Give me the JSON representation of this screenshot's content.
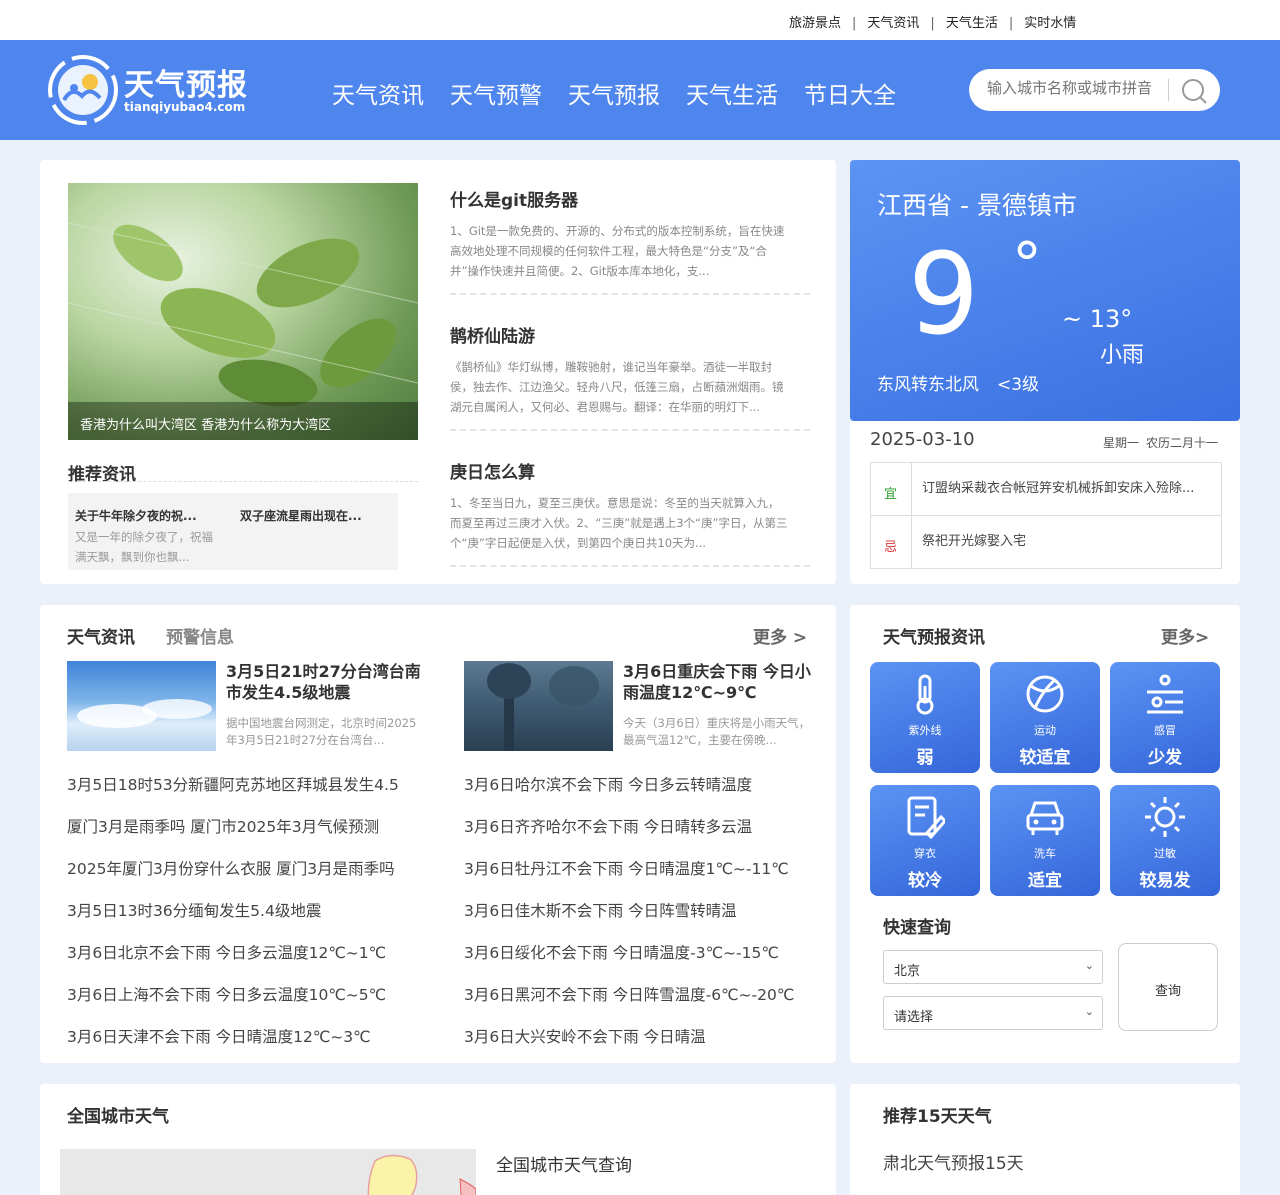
{
  "toplinks": [
    "旅游景点",
    "天气资讯",
    "天气生活",
    "实时水情"
  ],
  "logo": {
    "title": "天气预报",
    "subtitle": "tianqiyubao4.com"
  },
  "nav": [
    "天气资讯",
    "天气预警",
    "天气预报",
    "天气生活",
    "节日大全"
  ],
  "search": {
    "placeholder": "输入城市名称或城市拼音"
  },
  "featured": {
    "caption": "香港为什么叫大湾区 香港为什么称为大湾区",
    "articles": [
      {
        "title": "什么是git服务器",
        "desc": "1、Git是一款免费的、开源的、分布式的版本控制系统，旨在快速高效地处理不同规模的任何软件工程，最大特色是“分支”及“合并”操作快速并且简便。2、Git版本库本地化，支..."
      },
      {
        "title": "鹊桥仙陆游",
        "desc": "《鹊桥仙》华灯纵博，雕鞍驰射，谁记当年豪举。酒徒一半取封侯，独去作、江边渔父。轻舟八尺，低篷三扇，占断蘋洲烟雨。镜湖元自属闲人，又何必、君恩赐与。翻译：在华丽的明灯下..."
      },
      {
        "title": "庚日怎么算",
        "desc": "1、冬至当日九，夏至三庚伏。意思是说：冬至的当天就算入九，而夏至再过三庚才入伏。2、“三庚”就是遇上3个“庚”字日，从第三个“庚”字日起便是入伏，到第四个庚日共10天为..."
      }
    ]
  },
  "recommend": {
    "title": "推荐资讯",
    "items": [
      {
        "title": "关于牛年除夕夜的祝...",
        "desc": "又是一年的除夕夜了，祝福满天飘，飘到你也飘..."
      },
      {
        "title": "双子座流星雨出现在...",
        "desc": ""
      }
    ]
  },
  "weather": {
    "location": "江西省 - 景德镇市",
    "temp": "9",
    "deg": "°",
    "high": "~ 13°",
    "condition": "小雨",
    "wind": "东风转东北风",
    "wind_level": "<3级",
    "date": "2025-03-10",
    "weekday": "星期一",
    "lunar": "农历二月十一",
    "yi_label": "宜",
    "yi": "订盟纳采裁衣合帐冠笄安机械拆卸安床入殓除...",
    "ji_label": "忌",
    "ji": "祭祀开光嫁娶入宅"
  },
  "news": {
    "tabs": [
      "天气资讯",
      "预警信息"
    ],
    "more": "更多 >",
    "featured": [
      {
        "title": "3月5日21时27分台湾台南市发生4.5级地震",
        "desc": "据中国地震台网测定，北京时间2025年3月5日21时27分在台湾台..."
      },
      {
        "title": "3月6日重庆会下雨 今日小雨温度12℃~9℃",
        "desc": "今天（3月6日）重庆将是小雨天气，最高气温12℃，主要在傍晚..."
      }
    ],
    "left": [
      "3月5日18时53分新疆阿克苏地区拜城县发生4.5",
      "厦门3月是雨季吗 厦门市2025年3月气候预测",
      "2025年厦门3月份穿什么衣服 厦门3月是雨季吗",
      "3月5日13时36分缅甸发生5.4级地震",
      "3月6日北京不会下雨 今日多云温度12℃~1℃",
      "3月6日上海不会下雨 今日多云温度10℃~5℃",
      "3月6日天津不会下雨 今日晴温度12℃~3℃"
    ],
    "right": [
      "3月6日哈尔滨不会下雨 今日多云转晴温度",
      "3月6日齐齐哈尔不会下雨 今日晴转多云温",
      "3月6日牡丹江不会下雨 今日晴温度1℃~-11℃",
      "3月6日佳木斯不会下雨 今日阵雪转晴温",
      "3月6日绥化不会下雨 今日晴温度-3℃~-15℃",
      "3月6日黑河不会下雨 今日阵雪温度-6℃~-20℃",
      "3月6日大兴安岭不会下雨 今日晴温"
    ]
  },
  "forecast": {
    "title": "天气预报资讯",
    "more": "更多>",
    "tiles": [
      {
        "label": "紫外线",
        "value": "弱",
        "icon": "thermometer-icon"
      },
      {
        "label": "运动",
        "value": "较适宜",
        "icon": "ball-icon"
      },
      {
        "label": "感冒",
        "value": "少发",
        "icon": "cold-icon"
      },
      {
        "label": "穿衣",
        "value": "较冷",
        "icon": "clothing-icon"
      },
      {
        "label": "洗车",
        "value": "适宜",
        "icon": "car-icon"
      },
      {
        "label": "过敏",
        "value": "较易发",
        "icon": "sun-icon"
      }
    ],
    "quick_title": "快速查询",
    "select1": "北京",
    "select2": "请选择",
    "query": "查询"
  },
  "city": {
    "title": "全国城市天气",
    "subtitle": "全国城市天气查询"
  },
  "rec15": {
    "title": "推荐15天天气",
    "first": "肃北天气预报15天"
  }
}
